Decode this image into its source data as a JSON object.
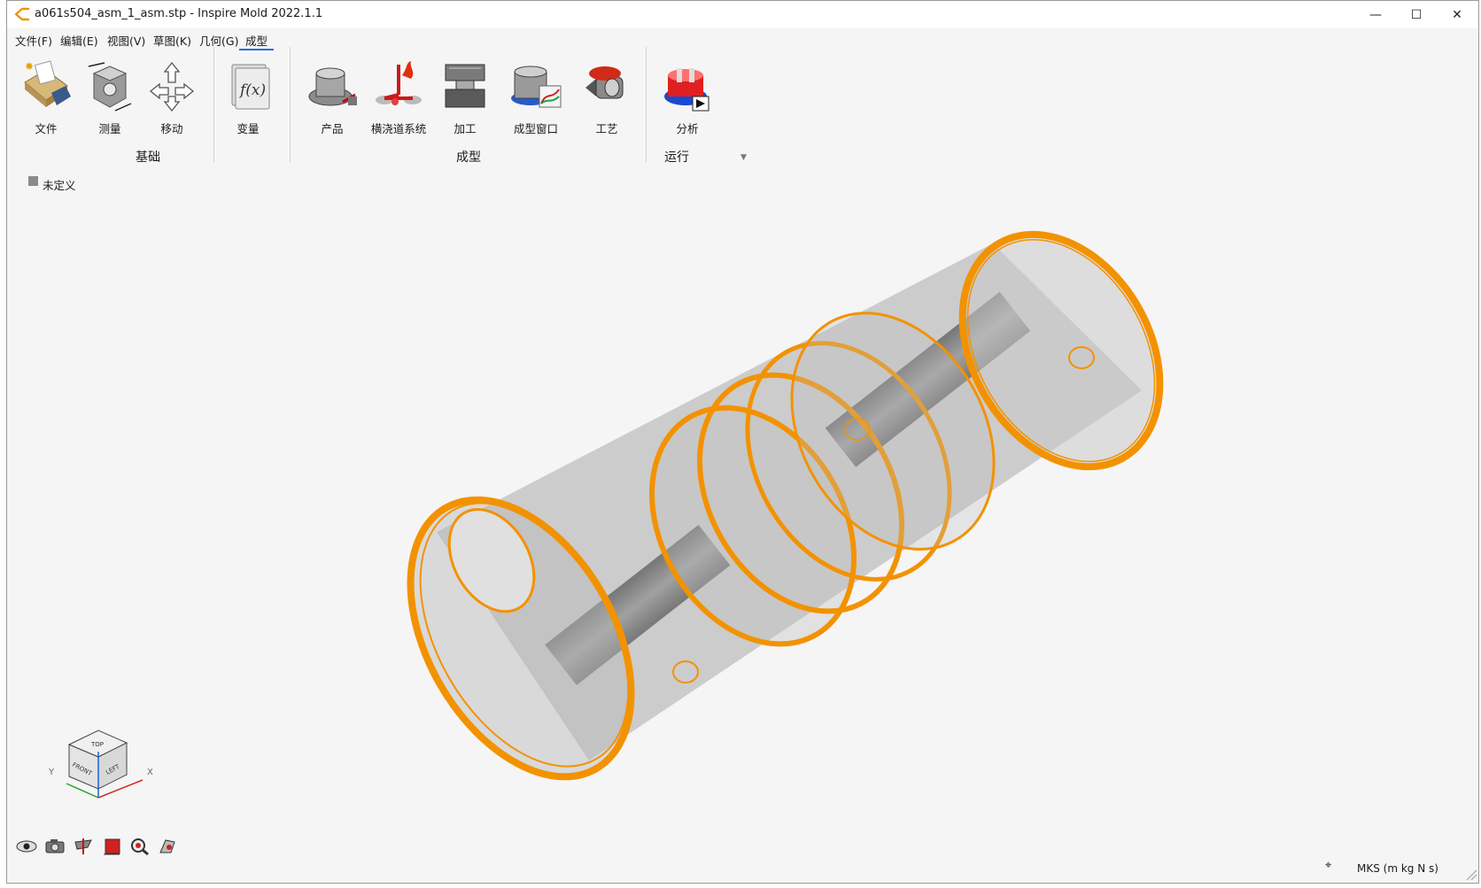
{
  "window": {
    "title": "a061s504_asm_1_asm.stp - Inspire Mold 2022.1.1",
    "controls": {
      "minimize": "—",
      "maximize": "☐",
      "close": "✕"
    },
    "app_icon": "inspire-logo-icon"
  },
  "menu": [
    {
      "label": "文件(F)"
    },
    {
      "label": "编辑(E)"
    },
    {
      "label": "视图(V)"
    },
    {
      "label": "草图(K)"
    },
    {
      "label": "几何(G)"
    },
    {
      "label": "成型",
      "active": true
    }
  ],
  "ribbon": {
    "groups": [
      {
        "label": "基础",
        "buttons": [
          {
            "label": "文件",
            "icon": "file-folder-icon"
          },
          {
            "label": "测量",
            "icon": "measure-icon"
          },
          {
            "label": "移动",
            "icon": "move-icon"
          }
        ]
      },
      {
        "label": "",
        "buttons": [
          {
            "label": "变量",
            "icon": "variable-fx-icon"
          }
        ]
      },
      {
        "label": "成型",
        "buttons": [
          {
            "label": "产品",
            "icon": "product-icon"
          },
          {
            "label": "横浇道系统",
            "icon": "runner-system-icon"
          },
          {
            "label": "加工",
            "icon": "machining-icon"
          },
          {
            "label": "成型窗口",
            "icon": "molding-window-icon"
          },
          {
            "label": "工艺",
            "icon": "process-icon"
          }
        ]
      },
      {
        "label": "运行",
        "buttons": [
          {
            "label": "分析",
            "icon": "analysis-icon"
          }
        ]
      }
    ]
  },
  "tree": {
    "item": "未定义",
    "swatch_color": "#8a8a8a"
  },
  "viewcube": {
    "faces": [
      "TOP",
      "FRONT",
      "LEFT"
    ],
    "axes": [
      "Y",
      "X"
    ]
  },
  "bottom_tools": [
    "visibility-eye-icon",
    "camera-icon",
    "section-view-icon",
    "box-select-icon",
    "zoom-icon",
    "view-3d-icon"
  ],
  "status": {
    "units": "MKS (m kg N s)",
    "snap_icon": "crosshair-icon"
  },
  "colors": {
    "accent": "#f39200",
    "highlight": "#f39200",
    "background": "#f5f5f5",
    "selection_tab": "#1e6fd9"
  }
}
